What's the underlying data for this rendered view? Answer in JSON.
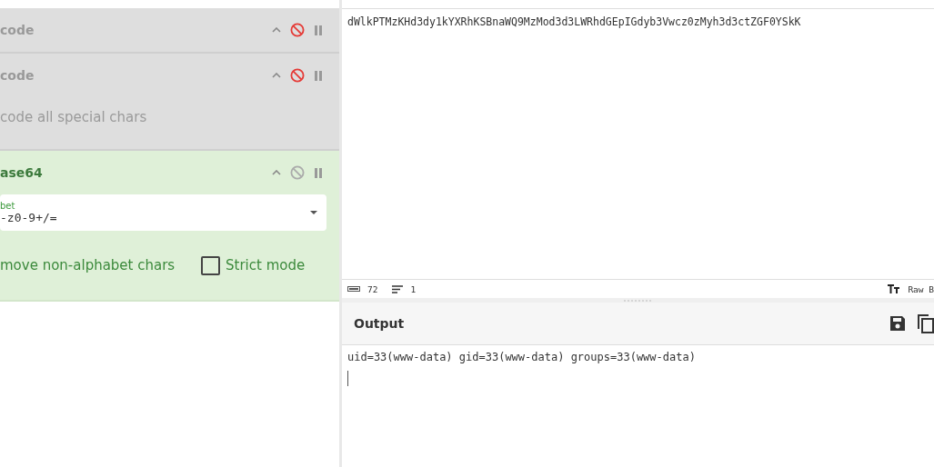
{
  "recipe": [
    {
      "title": "code",
      "disabled": true
    },
    {
      "title": "code",
      "disabled": true,
      "options": [
        {
          "kind": "text",
          "label": "code all special chars"
        }
      ]
    },
    {
      "title": "ase64",
      "disabled": false,
      "options": [
        {
          "kind": "select",
          "label": "bet",
          "value": "-z0-9+/="
        },
        {
          "kind": "checks",
          "label": "move non-alphabet chars",
          "box_label": "Strict mode",
          "checked": false
        }
      ]
    }
  ],
  "input": {
    "value": "dWlkPTMzKHd3dy1kYXRhKSBnaWQ9MzMod3d3LWRhdGEpIGdyb3Vwcz0zMyh3d3ctZGF0YSkK"
  },
  "status_bar": {
    "length": "72",
    "lines": "1",
    "format": "Raw B"
  },
  "output": {
    "title": "Output",
    "value": "uid=33(www-data) gid=33(www-data) groups=33(www-data)"
  }
}
